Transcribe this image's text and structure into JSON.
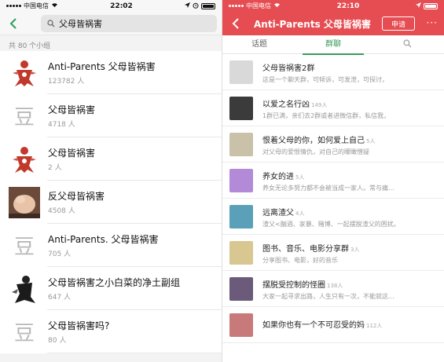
{
  "left": {
    "status": {
      "carrier": "中国电信",
      "time": "22:02"
    },
    "search": {
      "query": "父母皆祸害"
    },
    "count_label": "共 80 个小组",
    "groups": [
      {
        "name": "Anti-Parents 父母皆祸害",
        "members": "123782 人",
        "avatar": "red-figure"
      },
      {
        "name": "父母皆祸害",
        "members": "4718 人",
        "avatar": "dou-placeholder"
      },
      {
        "name": "父母皆祸害",
        "members": "2 人",
        "avatar": "red-figure"
      },
      {
        "name": "反父母皆祸害",
        "members": "4508 人",
        "avatar": "baby-photo"
      },
      {
        "name": "Anti-Parents. 父母皆祸害",
        "members": "705 人",
        "avatar": "dou-placeholder"
      },
      {
        "name": "父母皆祸害之小白菜的净土副组",
        "members": "647 人",
        "avatar": "bw-figure"
      },
      {
        "name": "父母皆祸害吗?",
        "members": "80 人",
        "avatar": "dou-placeholder"
      }
    ],
    "placeholder_glyph": "豆"
  },
  "right": {
    "status": {
      "carrier": "中国电信",
      "time": "22:10"
    },
    "title": "Anti-Parents 父母皆祸害",
    "apply_label": "申请",
    "more_label": "···",
    "tabs": [
      {
        "label": "话题"
      },
      {
        "label": "群聊",
        "active": true
      },
      {
        "label": ""
      }
    ],
    "chats": [
      {
        "name": "父母皆祸害2群",
        "count": "",
        "desc": "这是一个聊天群，可倾诉，可发泄，可探讨，",
        "color": "#d9d9d9"
      },
      {
        "name": "以爱之名行凶",
        "count": "149人",
        "desc": "1群已满，亲们去2群或者进微信群，私信我，",
        "color": "#3b3b3b"
      },
      {
        "name": "恨着父母的你，如何爱上自己",
        "count": "5人",
        "desc": "对父母的爱恨情仇，对自己的矇瞰憎疑",
        "color": "#c9c2a8"
      },
      {
        "name": "养女的进",
        "count": "5人",
        "desc": "养女无论多努力都不会被当成一家人。常与痛…",
        "color": "#b38ad8"
      },
      {
        "name": "远离渣父",
        "count": "4人",
        "desc": "渣父<酗酒、家暴、赌博、一起摆脱渣父的困扰。",
        "color": "#5aa0b8"
      },
      {
        "name": "图书、音乐、电影分享群",
        "count": "3人",
        "desc": "分享图书、电影，好的音乐",
        "color": "#d8c790"
      },
      {
        "name": "摆脱受控制的怪圈",
        "count": "138人",
        "desc": "大家一起寻求出路，人生只有一次，不能就这…",
        "color": "#6b5a7a"
      },
      {
        "name": "如果你也有一个不可忍受的妈",
        "count": "112人",
        "desc": "",
        "color": "#c87a7a"
      }
    ]
  },
  "colors": {
    "accent_red": "#e64d52",
    "accent_green": "#3a9b5a"
  }
}
